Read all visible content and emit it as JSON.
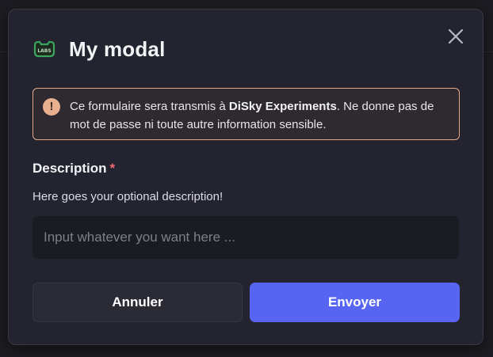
{
  "modal": {
    "title": "My modal",
    "app_icon_label": "LABS",
    "close_icon": "close-icon"
  },
  "warning": {
    "icon": "exclamation-icon",
    "icon_glyph": "!",
    "text_before": "Ce formulaire sera transmis à ",
    "app_name": "DiSky Experiments",
    "text_after": ". Ne donne pas de mot de passe ni toute autre information sensible."
  },
  "field": {
    "label": "Description",
    "required_marker": "*",
    "description": "Here goes your optional description!",
    "value": "",
    "placeholder": "Input whatever you want here ..."
  },
  "buttons": {
    "cancel_label": "Annuler",
    "submit_label": "Envoyer"
  },
  "colors": {
    "accent": "#5865f2",
    "warning_border": "#e6a886",
    "required": "#f0686e",
    "app_icon": "#3ba55c"
  }
}
